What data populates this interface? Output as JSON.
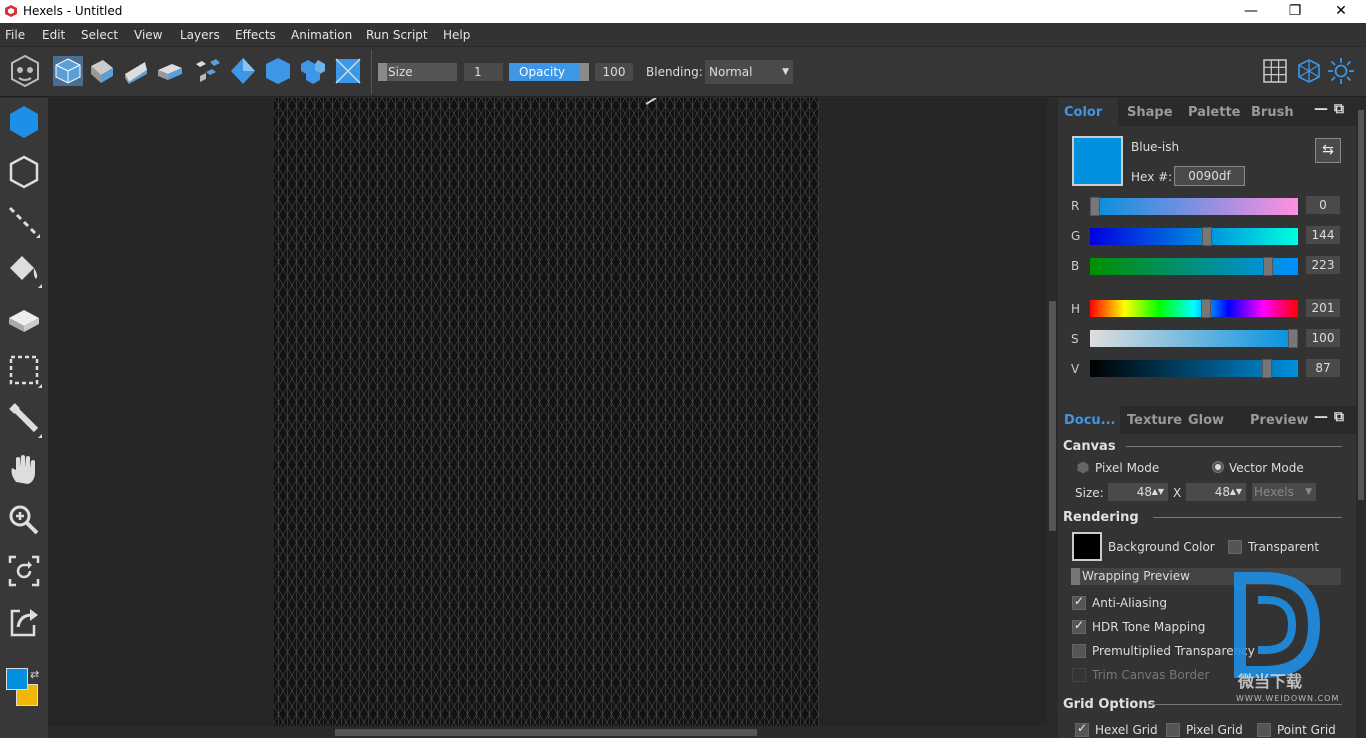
{
  "window": {
    "title": "Hexels - Untitled",
    "minimize": "—",
    "maximize": "❐",
    "close": "✕"
  },
  "menu": [
    "File",
    "Edit",
    "Select",
    "View",
    "Layers",
    "Effects",
    "Animation",
    "Run Script",
    "Help"
  ],
  "toolbar": {
    "size_label": "Size",
    "size_value": "1",
    "opacity_label": "Opacity",
    "opacity_value": "100",
    "blending_label": "Blending:",
    "blending_value": "Normal"
  },
  "color_panel": {
    "tabs": [
      "Color",
      "Shape",
      "Palette",
      "Brush"
    ],
    "active_tab": "Color",
    "swatch_color": "#0090df",
    "color_name": "Blue-ish",
    "hex_label": "Hex #:",
    "hex_value": "0090df",
    "channels": [
      {
        "name": "R",
        "value": "0",
        "level": 0.0
      },
      {
        "name": "G",
        "value": "144",
        "level": 0.565
      },
      {
        "name": "B",
        "value": "223",
        "level": 0.875
      },
      {
        "name": "H",
        "value": "201",
        "level": 0.56
      },
      {
        "name": "S",
        "value": "100",
        "level": 1.0
      },
      {
        "name": "V",
        "value": "87",
        "level": 0.87
      }
    ]
  },
  "doc_panel": {
    "tabs": [
      "Docu...",
      "Texture",
      "Glow",
      "Preview"
    ],
    "active_tab": "Docu...",
    "canvas_title": "Canvas",
    "pixel_mode": "Pixel Mode",
    "vector_mode": "Vector Mode",
    "size_label": "Size:",
    "width": "48",
    "x_label": "X",
    "height": "48",
    "unit": "Hexels",
    "rendering_title": "Rendering",
    "background_color_label": "Background Color",
    "transparent_label": "Transparent",
    "wrapping_preview": "Wrapping Preview",
    "anti_aliasing": "Anti-Aliasing",
    "hdr_tone_mapping": "HDR Tone Mapping",
    "premultiplied": "Premultiplied Transparency",
    "trim_canvas_border": "Trim Canvas Border",
    "grid_options_title": "Grid Options",
    "hexel_grid": "Hexel Grid",
    "pixel_grid": "Pixel Grid",
    "point_grid": "Point Grid"
  },
  "watermark": {
    "text": "微当下载",
    "url": "WWW.WEIDOWN.COM"
  },
  "colors": {
    "accent": "#3d96e6",
    "primary": "#0090df",
    "secondary": "#f2b705"
  }
}
